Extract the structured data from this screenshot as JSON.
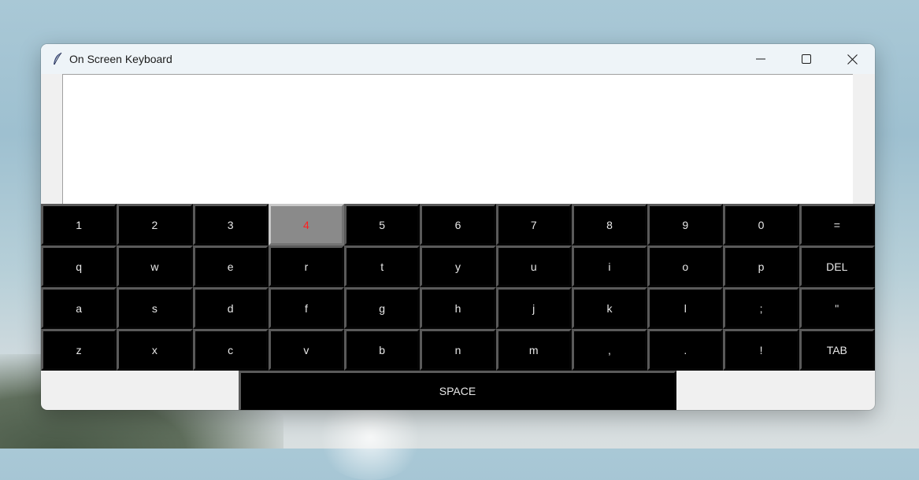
{
  "window": {
    "title": "On Screen Keyboard",
    "app_icon": "feather-icon",
    "controls": [
      "minimize-icon",
      "maximize-icon",
      "close-icon"
    ]
  },
  "text_area": {
    "value": ""
  },
  "keyboard": {
    "rows": [
      [
        "1",
        "2",
        "3",
        "4",
        "5",
        "6",
        "7",
        "8",
        "9",
        "0",
        "="
      ],
      [
        "q",
        "w",
        "e",
        "r",
        "t",
        "y",
        "u",
        "i",
        "o",
        "p",
        "DEL"
      ],
      [
        "a",
        "s",
        "d",
        "f",
        "g",
        "h",
        "j",
        "k",
        "l",
        ";",
        "\""
      ],
      [
        "z",
        "x",
        "c",
        "v",
        "b",
        "n",
        "m",
        ",",
        ".",
        "!",
        "TAB"
      ]
    ],
    "active_key": "4",
    "space_label": "SPACE"
  },
  "colors": {
    "key_bg": "#000000",
    "key_text": "#e8e8e8",
    "active_key_bg": "#8a8a8a",
    "active_key_text": "#ff2020"
  }
}
